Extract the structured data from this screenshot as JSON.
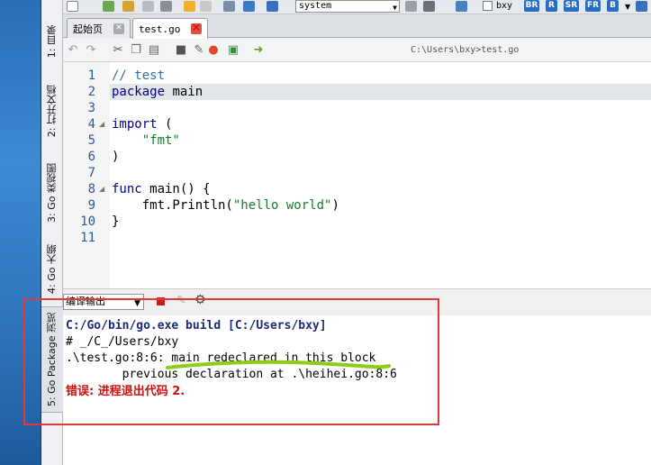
{
  "dock": {
    "tabs": [
      {
        "label": "1: 目录"
      },
      {
        "label": "2: 打开文档"
      },
      {
        "label": "3: Go 类视图"
      },
      {
        "label": "4: Go 大纲"
      },
      {
        "label": "5: Go Package 浏览"
      }
    ]
  },
  "main_toolbar": {
    "system_select": "system",
    "checkbox_label": "bxy",
    "badges": [
      "BR",
      "R",
      "SR",
      "FR",
      "B"
    ]
  },
  "tabs": [
    {
      "label": "起始页",
      "active": false
    },
    {
      "label": "test.go",
      "active": true
    }
  ],
  "editor_toolbar": {
    "path": "C:\\Users\\bxy>test.go"
  },
  "editor": {
    "line_numbers": [
      "1",
      "2",
      "3",
      "4",
      "5",
      "6",
      "7",
      "8",
      "9",
      "10",
      "11"
    ],
    "lines": [
      {
        "n": "1",
        "parts": [
          {
            "t": "// test",
            "c": "cm"
          }
        ]
      },
      {
        "n": "2",
        "parts": [
          {
            "t": "package",
            "c": "kw"
          },
          {
            "t": " main",
            "c": ""
          }
        ],
        "highlight": true
      },
      {
        "n": "3",
        "parts": []
      },
      {
        "n": "4",
        "parts": [
          {
            "t": "import",
            "c": "kw"
          },
          {
            "t": " (",
            "c": ""
          }
        ]
      },
      {
        "n": "5",
        "parts": [
          {
            "t": "    ",
            "c": ""
          },
          {
            "t": "\"fmt\"",
            "c": "str"
          }
        ]
      },
      {
        "n": "6",
        "parts": [
          {
            "t": ")",
            "c": ""
          }
        ]
      },
      {
        "n": "7",
        "parts": []
      },
      {
        "n": "8",
        "parts": [
          {
            "t": "func",
            "c": "kw"
          },
          {
            "t": " main() {",
            "c": ""
          }
        ]
      },
      {
        "n": "9",
        "parts": [
          {
            "t": "    fmt.Println(",
            "c": ""
          },
          {
            "t": "\"hello world\"",
            "c": "str"
          },
          {
            "t": ")",
            "c": ""
          }
        ]
      },
      {
        "n": "10",
        "parts": [
          {
            "t": "}",
            "c": ""
          }
        ]
      },
      {
        "n": "11",
        "parts": []
      }
    ]
  },
  "output": {
    "select_label": "编译输出",
    "lines": {
      "l1": "C:/Go/bin/go.exe build [C:/Users/bxy]",
      "l2": "# _/C_/Users/bxy",
      "l3": ".\\test.go:8:6: main redeclared in this block",
      "l4": "        previous declaration at .\\heihei.go:8:6",
      "l5": "错误: 进程退出代码 2."
    }
  },
  "colors": {
    "annotation_box": "#e03a3a",
    "annotation_underline": "#8fcc1a",
    "error_text": "#cc1010"
  }
}
